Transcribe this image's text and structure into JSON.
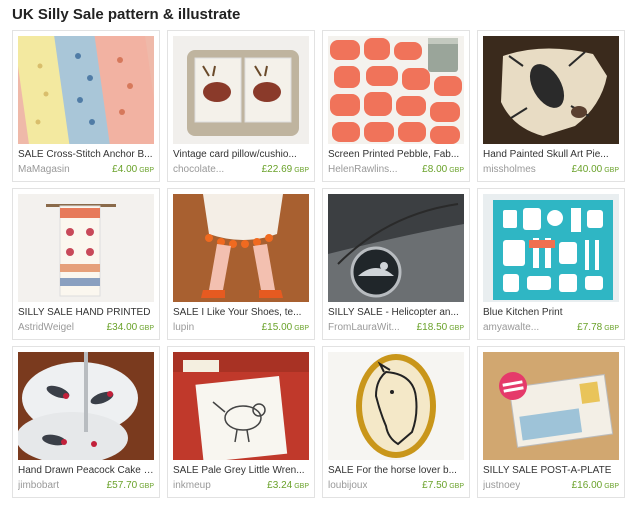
{
  "page": {
    "title": "UK Silly Sale pattern & illustrate"
  },
  "items": [
    {
      "title": "SALE Cross-Stitch Anchor B...",
      "shop": "MaMagasin",
      "price": "£4.00",
      "currency": "GBP",
      "image": "anchor-tea-towels"
    },
    {
      "title": "Vintage card pillow/cushio...",
      "shop": "chocolate...",
      "price": "£22.69",
      "currency": "GBP",
      "image": "stag-card-pillow"
    },
    {
      "title": "Screen Printed Pebble, Fab...",
      "shop": "HelenRawlins...",
      "price": "£8.00",
      "currency": "GBP",
      "image": "orange-pebble-fabric"
    },
    {
      "title": "Hand Painted Skull Art Pie...",
      "shop": "missholmes",
      "price": "£40.00",
      "currency": "GBP",
      "image": "painted-skull"
    },
    {
      "title": "SILLY SALE HAND PRINTED",
      "shop": "AstridWeigel",
      "price": "£34.00",
      "currency": "GBP",
      "image": "printed-wall-hanging"
    },
    {
      "title": "SALE I Like Your Shoes, te...",
      "shop": "lupin",
      "price": "£15.00",
      "currency": "GBP",
      "image": "felt-shoes"
    },
    {
      "title": "SILLY SALE - Helicopter an...",
      "shop": "FromLauraWit...",
      "price": "£18.50",
      "currency": "GBP",
      "image": "helicopter-pendant"
    },
    {
      "title": "Blue Kitchen Print",
      "shop": "amyawalte...",
      "price": "£7.78",
      "currency": "GBP",
      "image": "blue-kitchen-print"
    },
    {
      "title": "Hand Drawn Peacock Cake St...",
      "shop": "jimbobart",
      "price": "£57.70",
      "currency": "GBP",
      "image": "peacock-cake-stand"
    },
    {
      "title": "SALE Pale Grey Little Wren...",
      "shop": "inkmeup",
      "price": "£3.24",
      "currency": "GBP",
      "image": "wren-print"
    },
    {
      "title": "SALE For the horse lover b...",
      "shop": "loubijoux",
      "price": "£7.50",
      "currency": "GBP",
      "image": "horse-cameo"
    },
    {
      "title": "SILLY SALE POST-A-PLATE",
      "shop": "justnoey",
      "price": "£16.00",
      "currency": "GBP",
      "image": "post-a-plate"
    }
  ]
}
